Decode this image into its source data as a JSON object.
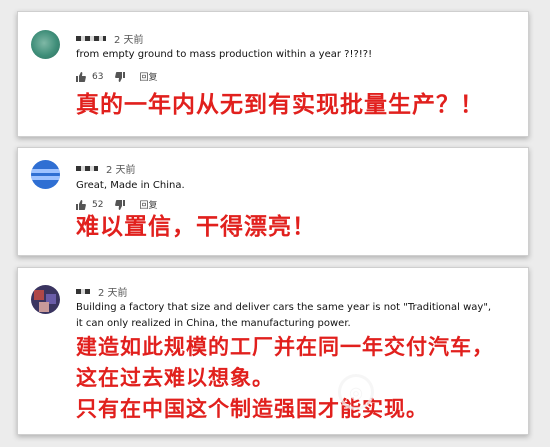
{
  "comments": [
    {
      "timestamp": "2 天前",
      "text_lines": [
        "from empty ground to mass production within a year ?!?!?!"
      ],
      "likes": "63",
      "reply_label": "回复",
      "translation_lines": [
        "真的一年内从无到有实现批量生产？！"
      ]
    },
    {
      "timestamp": "2 天前",
      "text_lines": [
        "Great, Made in China."
      ],
      "likes": "52",
      "reply_label": "回复",
      "translation_lines": [
        "难以置信，干得漂亮！"
      ]
    },
    {
      "timestamp": "2 天前",
      "text_lines": [
        "Building a factory that size and deliver cars the same year is not \"Traditional way\",",
        "it can only realized in China, the manufacturing power."
      ],
      "translation_lines": [
        "建造如此规模的工厂并在同一年交付汽车，",
        "这在过去难以想象。",
        "只有在中国这个制造强国才能实现。"
      ]
    }
  ],
  "colors": {
    "translation": "#e1201d",
    "card_bg": "#ffffff",
    "page_bg": "#ececec"
  },
  "icons": [
    "avatar",
    "thumbs-up-icon",
    "thumbs-down-icon",
    "watermark-logo-icon"
  ]
}
